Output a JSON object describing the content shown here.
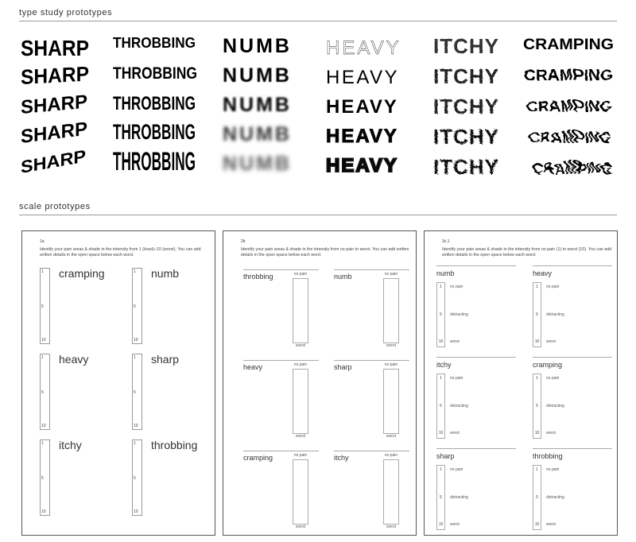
{
  "sections": {
    "type_study": "type study prototypes",
    "scale": "scale prototypes"
  },
  "type_study": {
    "columns": [
      {
        "word": "SHARP",
        "words": [
          "SHARP",
          "SHARP",
          "SHARP",
          "SHARP",
          "SHARP"
        ]
      },
      {
        "word": "THROBBING",
        "words": [
          "THROBBING",
          "THROBBING",
          "THROBBING",
          "THROBBING",
          "THROBBING"
        ]
      },
      {
        "word": "NUMB",
        "words": [
          "NUMB",
          "NUMB",
          "NUMB",
          "NUMB",
          "NUMB"
        ]
      },
      {
        "word": "HEAVY",
        "words": [
          "HEAVY",
          "HEAVY",
          "HEAVY",
          "HEAVY",
          "HEAVY"
        ]
      },
      {
        "word": "ITCHY",
        "words": [
          "ITCHY",
          "ITCHY",
          "ITCHY",
          "ITCHY",
          "ITCHY"
        ]
      },
      {
        "word": "CRAMPING",
        "words": [
          "CRAMPING",
          "CRAMPING",
          "CRAMPING",
          "CRAMPING",
          "CRAMPING"
        ]
      }
    ]
  },
  "scale_prototypes": [
    {
      "id": "1a",
      "instructions": "Identify your pain areas & shade in the intensity from 1 (least)–10 (worst). You can add written details in the open space below each word.",
      "marks": [
        "1",
        "5",
        "10"
      ],
      "words": [
        "cramping",
        "numb",
        "heavy",
        "sharp",
        "itchy",
        "throbbing"
      ]
    },
    {
      "id": "2b",
      "instructions": "Identify your pain areas & shade in the intensity from no pain to worst. You can add written details in the open space below each word.",
      "top_label": "no pain",
      "bottom_label": "worst",
      "words": [
        "throbbing",
        "numb",
        "heavy",
        "sharp",
        "cramping",
        "itchy"
      ]
    },
    {
      "id": "3c.1",
      "instructions": "Identify your pain areas & shade in the intensity from no pain (1) to worst (10). You can add written details in the open space below each word.",
      "marks": [
        "1",
        "5",
        "10"
      ],
      "levels": [
        "no pain",
        "distracting",
        "worst"
      ],
      "words": [
        "numb",
        "heavy",
        "itchy",
        "cramping",
        "sharp",
        "throbbing"
      ]
    }
  ]
}
